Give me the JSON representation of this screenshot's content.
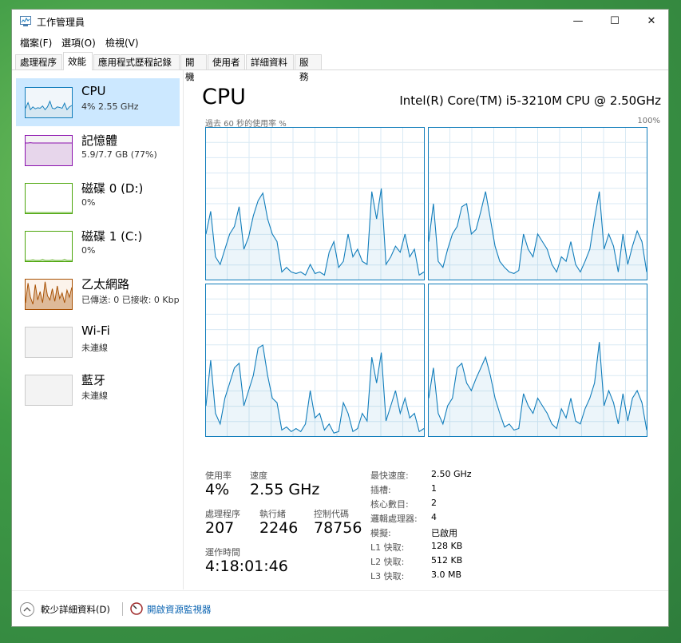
{
  "window": {
    "title": "工作管理員"
  },
  "window_controls": {
    "minimize": "—",
    "maximize": "☐",
    "close": "✕"
  },
  "menu": [
    "檔案(F)",
    "選項(O)",
    "檢視(V)"
  ],
  "tabs": [
    "處理程序",
    "效能",
    "應用程式歷程記錄",
    "開機",
    "使用者",
    "詳細資料",
    "服務"
  ],
  "active_tab": "效能",
  "sidebar": [
    {
      "name": "CPU",
      "sub": "4%  2.55 GHz",
      "color": "#117dbb",
      "bg": "#f1f6fa",
      "selected": true
    },
    {
      "name": "記憶體",
      "sub": "5.9/7.7 GB (77%)",
      "color": "#8b12ae",
      "bg": "#f4f2f4",
      "selected": false
    },
    {
      "name": "磁碟 0 (D:)",
      "sub": "0%",
      "color": "#4da60c",
      "bg": "#ffffff",
      "selected": false
    },
    {
      "name": "磁碟 1 (C:)",
      "sub": "0%",
      "color": "#4da60c",
      "bg": "#ffffff",
      "selected": false
    },
    {
      "name": "乙太網路",
      "sub": "已傳送: 0 已接收: 0 Kbp",
      "color": "#a74f01",
      "bg": "#fcf3eb",
      "selected": false
    },
    {
      "name": "Wi-Fi",
      "sub": "未連線",
      "color": "#cccccc",
      "bg": "#f3f3f3",
      "selected": false
    },
    {
      "name": "藍牙",
      "sub": "未連線",
      "color": "#cccccc",
      "bg": "#f3f3f3",
      "selected": false
    }
  ],
  "main": {
    "title": "CPU",
    "model": "Intel(R) Core(TM) i5-3210M CPU @ 2.50GHz",
    "graph_caption": "過去 60 秒的使用率 %",
    "graph_max": "100%"
  },
  "stats": {
    "usage_label": "使用率",
    "usage_value": "4%",
    "speed_label": "速度",
    "speed_value": "2.55 GHz",
    "processes_label": "處理程序",
    "processes_value": "207",
    "threads_label": "執行緒",
    "threads_value": "2246",
    "handles_label": "控制代碼",
    "handles_value": "78756",
    "uptime_label": "運作時間",
    "uptime_value": "4:18:01:46"
  },
  "specs": [
    {
      "label": "最快速度:",
      "value": "2.50 GHz"
    },
    {
      "label": "插槽:",
      "value": "1"
    },
    {
      "label": "核心數目:",
      "value": "2"
    },
    {
      "label": "邏輯處理器:",
      "value": "4"
    },
    {
      "label": "模擬:",
      "value": "已啟用"
    },
    {
      "label": "L1 快取:",
      "value": "128 KB"
    },
    {
      "label": "L2 快取:",
      "value": "512 KB"
    },
    {
      "label": "L3 快取:",
      "value": "3.0 MB"
    }
  ],
  "footer": {
    "fewer_details": "較少詳細資料(D)",
    "resource_monitor": "開啟資源監視器"
  },
  "core_graphs": [
    [
      30,
      45,
      15,
      10,
      20,
      30,
      35,
      48,
      20,
      28,
      42,
      52,
      57,
      40,
      30,
      25,
      5,
      8,
      5,
      4,
      5,
      3,
      10,
      4,
      5,
      3,
      18,
      25,
      8,
      12,
      30,
      15,
      20,
      12,
      10,
      58,
      40,
      60,
      10,
      15,
      22,
      18,
      30,
      15,
      20,
      3,
      5
    ],
    [
      25,
      50,
      12,
      8,
      20,
      30,
      35,
      48,
      50,
      30,
      33,
      45,
      58,
      40,
      22,
      12,
      8,
      5,
      4,
      6,
      30,
      20,
      15,
      30,
      25,
      20,
      10,
      5,
      15,
      12,
      25,
      10,
      5,
      12,
      20,
      40,
      58,
      20,
      30,
      22,
      5,
      30,
      10,
      22,
      32,
      25,
      5
    ],
    [
      20,
      50,
      15,
      8,
      25,
      35,
      45,
      48,
      20,
      30,
      40,
      58,
      60,
      40,
      25,
      22,
      4,
      6,
      3,
      5,
      3,
      8,
      30,
      12,
      15,
      4,
      8,
      2,
      3,
      22,
      15,
      3,
      5,
      15,
      10,
      52,
      35,
      55,
      10,
      20,
      30,
      15,
      25,
      12,
      15,
      3,
      5
    ],
    [
      25,
      45,
      15,
      8,
      20,
      25,
      45,
      48,
      35,
      30,
      38,
      45,
      52,
      40,
      25,
      15,
      6,
      8,
      4,
      5,
      28,
      20,
      15,
      25,
      20,
      15,
      8,
      5,
      18,
      12,
      25,
      10,
      8,
      18,
      25,
      35,
      62,
      20,
      30,
      22,
      8,
      28,
      10,
      25,
      30,
      22,
      4
    ]
  ],
  "sidebar_graphs": {
    "cpu": [
      30,
      50,
      25,
      35,
      28,
      32,
      30,
      38,
      25,
      35,
      55,
      30,
      28,
      35,
      33,
      30,
      48,
      25,
      35,
      40
    ],
    "memory": [
      77,
      77,
      78,
      77,
      77,
      77,
      77,
      77,
      77,
      77,
      77,
      77,
      77,
      77,
      77,
      77,
      77,
      77,
      77,
      77
    ],
    "disk0": [
      0,
      0,
      0,
      0,
      0,
      0,
      0,
      0,
      0,
      0,
      0,
      0,
      0,
      0,
      0,
      0,
      0,
      0,
      0,
      0
    ],
    "disk1": [
      0,
      0,
      0,
      2,
      0,
      0,
      0,
      3,
      0,
      0,
      0,
      2,
      0,
      0,
      0,
      0,
      3,
      0,
      0,
      0
    ],
    "ethernet": [
      20,
      90,
      40,
      15,
      85,
      30,
      60,
      20,
      95,
      45,
      30,
      70,
      25,
      80,
      35,
      55,
      20,
      65,
      40,
      75
    ]
  }
}
